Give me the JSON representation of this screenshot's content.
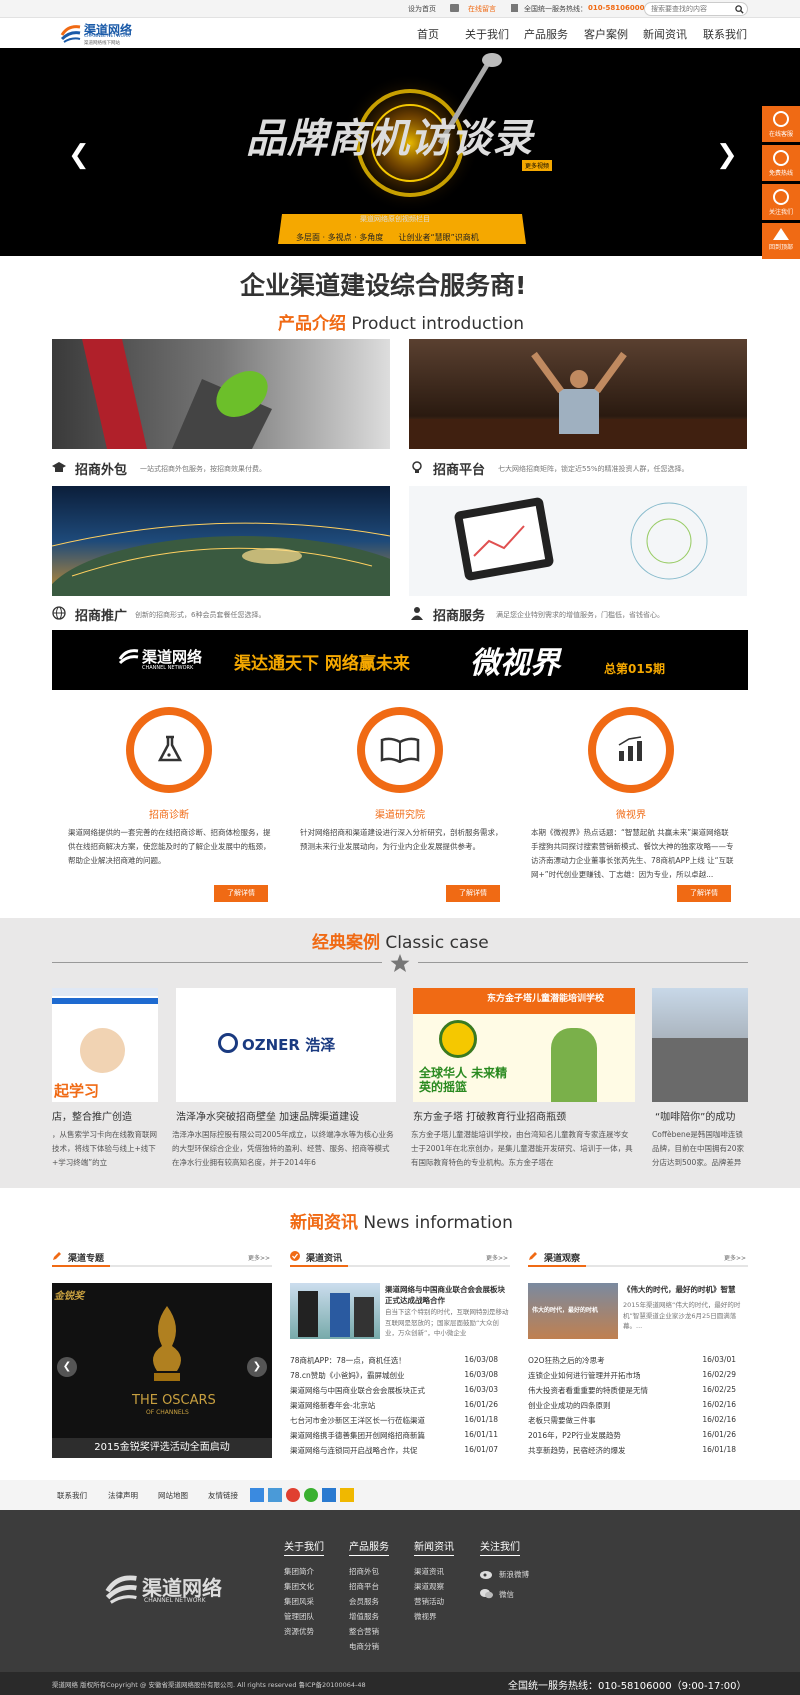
{
  "topbar": {
    "set_home": "设为首页",
    "online_msg": "在线留言",
    "hotline_label": "全国统一服务热线：",
    "hotline": "010-58106000",
    "search_placeholder": "搜索要查找的内容"
  },
  "header": {
    "logo_cn": "渠道网络",
    "logo_en": "CHANNEL NETWORK",
    "logo_sub": "渠道网络线下网站",
    "nav": [
      "首页",
      "关于我们",
      "产品服务",
      "客户案例",
      "新闻资讯",
      "联系我们"
    ]
  },
  "banner": {
    "headline": "品牌商机访谈录",
    "more_tag": "更多视频",
    "caption": "渠道网络原创视频栏目",
    "ribbon": "多层面 · 多视点 · 多角度      让创业者“慧眼”识商机",
    "prev": "❮",
    "next": "❯"
  },
  "float_bar": [
    "在线客服",
    "免费热线",
    "关注我们",
    "回到顶部"
  ],
  "slogan": "企业渠道建设综合服务商!",
  "products": {
    "title_cn": "产品介绍",
    "title_en": "Product introduction",
    "items": [
      {
        "title": "招商外包",
        "desc": "一站式招商外包服务，按招商效果付费。"
      },
      {
        "title": "招商平台",
        "desc": "七大网络招商矩阵，锁定近55%的精准投资人群，任您选择。"
      },
      {
        "title": "招商推广",
        "desc": "创新的招商形式，6种会员套餐任您选择。"
      },
      {
        "title": "招商服务",
        "desc": "满足您企业特别需求的增值服务，门槛低，省钱省心。"
      }
    ]
  },
  "promo_banner": {
    "logo": "渠道网络",
    "logo_en": "CHANNEL NETWORK",
    "slogan": "渠达通天下  网络赢未来",
    "brand": "微视界",
    "issue": "总第015期"
  },
  "services": [
    {
      "title": "招商诊断",
      "desc": "渠道网络提供的一套完善的在线招商诊断、招商体检服务，提供在线招商解决方案，使您能及时的了解企业发展中的瓶颈，帮助企业解决招商难的问题。",
      "more": "了解详情"
    },
    {
      "title": "渠道研究院",
      "desc": "针对网络招商和渠道建设进行深入分析研究，剖析服务需求，预测未来行业发展动向，为行业内企业发展提供参考。",
      "more": "了解详情"
    },
    {
      "title": "微视界",
      "desc": "本期《微视界》热点话题：“智慧起航 共赢未来”渠道网络联手搜狗共同探讨搜索营销新模式、餐饮大神的独家攻略——专访济南漂动力企业董事长张芮先生、78商机APP上线 让“互联网+”时代创业更赚钱、丁志雄：因为专业，所以卓越...",
      "more": "了解详情"
    }
  ],
  "cases": {
    "title_cn": "经典案例",
    "title_en": "Classic case",
    "items": [
      {
        "title": "店，整合推广创造",
        "desc": "，从售索学习卡向在线教育联网技术，将线下体验与线上+线下+学习终端”的立",
        "img_text": "起学习"
      },
      {
        "title": "浩泽净水突破招商壁垒 加速品牌渠道建设",
        "desc": "浩泽净水国际控股有限公司2005年成立，以终端净水等为核心业务的大型环保综合企业，凭借独特的盈利、经营、服务、招商等模式在净水行业拥有较高知名度，并于2014年6",
        "img_text": "OZNER 浩泽"
      },
      {
        "title": "东方金子塔 打破教育行业招商瓶颈",
        "desc": "东方金子塔儿童潜能培训学校，由台湾知名儿童教育专家连晟岑女士于2001年在北京创办，是集儿童潜能开发研究、培训于一体，具有国际教育特色的专业机构。东方金子塔在",
        "img_text": "东方金子塔儿童潜能培训学校",
        "img_sub": "全球华人 未来精英的摇篮"
      },
      {
        "title": "“咖啡陪你”的成功",
        "desc": "Coffèbene是韩国咖啡连锁品牌，目前在中国拥有20家分店达到500家。品牌差异化",
        "img_text": ""
      }
    ]
  },
  "news": {
    "title_cn": "新闻资讯",
    "title_en": "News information",
    "more": "更多>>",
    "col1": {
      "title": "渠道专题",
      "caption": "2015金锐奖评选活动全面启动",
      "img_brand": "金锐奖",
      "img_title": "THE OSCARS",
      "img_sub": "OF CHANNELS"
    },
    "col2": {
      "title": "渠道资讯",
      "feature_title": "渠道网络与中国商业联合会会展板块正式达成战略合作",
      "feature_desc": "自当下这个特别的时代，互联网特别是移动互联网是怒放的；国家层面鼓励“大众创业，万众创新”，中小微企业",
      "items": [
        {
          "t": "78商机APP：78一点，商机任选！",
          "d": "16/03/08"
        },
        {
          "t": "78.cn赞助《小爸妈》，霸屏城创业",
          "d": "16/03/08"
        },
        {
          "t": "渠道网络与中国商业联合会会展板块正式",
          "d": "16/03/03"
        },
        {
          "t": "渠道网络新春年会-北京站",
          "d": "16/01/26"
        },
        {
          "t": "七台河市金沙新区王洋区长一行莅临渠道",
          "d": "16/01/18"
        },
        {
          "t": "渠道网络携手德善集团开创网络招商新篇",
          "d": "16/01/11"
        },
        {
          "t": "渠道网络与连锁同开启战略合作，共促",
          "d": "16/01/07"
        }
      ]
    },
    "col3": {
      "title": "渠道观察",
      "feature_title": "《伟大的时代，最好的时机》智慧",
      "feature_desc": "2015年渠道网络“伟大的时代，最好的时机”智慧渠道企业家沙龙6月25日圆满落幕。...",
      "img_text": "伟大的时代，最好的时机",
      "items": [
        {
          "t": "O2O狂热之后的冷思考",
          "d": "16/03/01"
        },
        {
          "t": "连锁企业如何进行管理并开拓市场",
          "d": "16/02/29"
        },
        {
          "t": "伟大投资者看重重要的特质便是无情",
          "d": "16/02/25"
        },
        {
          "t": "创业企业成功的四条原则",
          "d": "16/02/16"
        },
        {
          "t": "老板只需要做三件事",
          "d": "16/02/16"
        },
        {
          "t": "2016年，P2P行业发展趋势",
          "d": "16/01/26"
        },
        {
          "t": "共享新趋势，民宿经济的爆发",
          "d": "16/01/18"
        }
      ]
    }
  },
  "linkbar": {
    "links": [
      "联系我们",
      "法律声明",
      "网站地图",
      "友情链接"
    ]
  },
  "footer": {
    "logo": "渠道网络",
    "logo_en": "CHANNEL NETWORK",
    "cols": [
      {
        "head": "关于我们",
        "items": [
          "集团简介",
          "集团文化",
          "集团风采",
          "管理团队",
          "资源优势"
        ]
      },
      {
        "head": "产品服务",
        "items": [
          "招商外包",
          "招商平台",
          "会员服务",
          "增值服务",
          "整合营销",
          "电商分销"
        ]
      },
      {
        "head": "新闻资讯",
        "items": [
          "渠道资讯",
          "渠道观察",
          "营销活动",
          "微视界"
        ]
      },
      {
        "head": "关注我们",
        "items": [
          "新浪微博",
          "微信"
        ]
      }
    ],
    "copyright": "渠道网络 版权所有Copyright @ 安徽省渠道网络股份有限公司. All rights reserved 鲁ICP备20100064-48",
    "hotline": "全国统一服务热线：010-58106000（9:00-17:00）"
  },
  "colors": {
    "accent": "#f06a14",
    "dark": "#3c3c3c"
  }
}
